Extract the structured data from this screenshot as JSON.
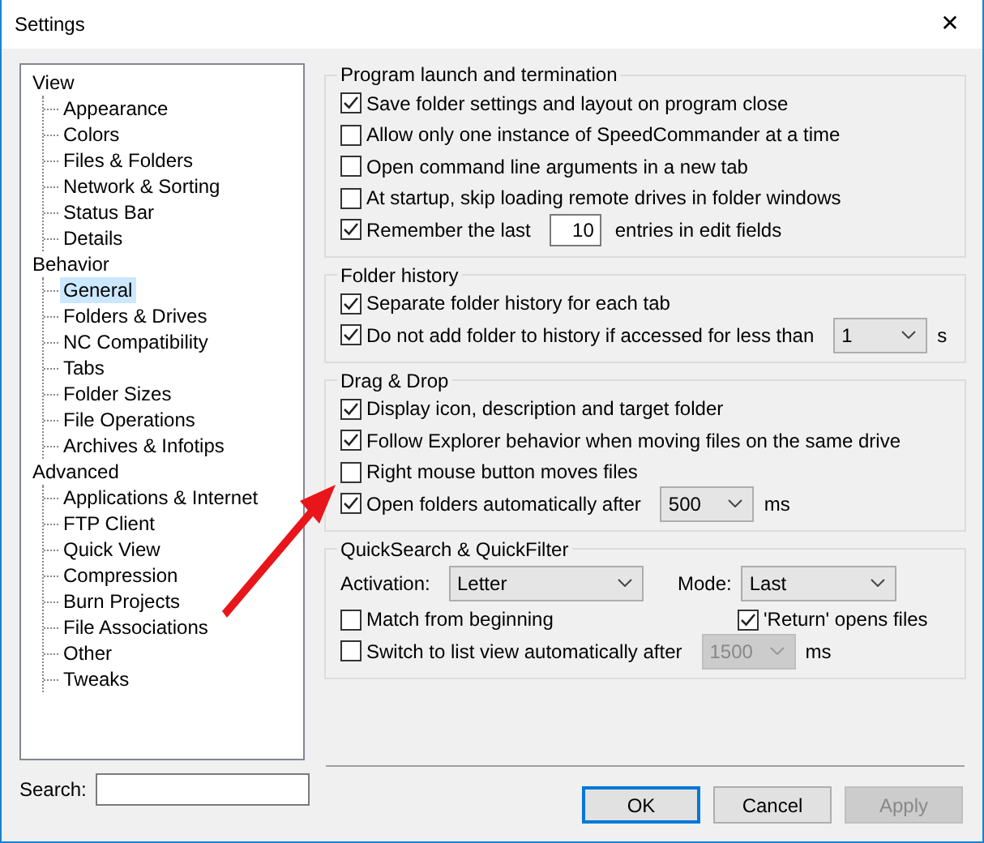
{
  "window": {
    "title": "Settings",
    "close": "✕"
  },
  "tree": [
    {
      "label": "View",
      "selected": false,
      "children": [
        {
          "label": "Appearance",
          "selected": false
        },
        {
          "label": "Colors",
          "selected": false
        },
        {
          "label": "Files & Folders",
          "selected": false
        },
        {
          "label": "Network & Sorting",
          "selected": false
        },
        {
          "label": "Status Bar",
          "selected": false
        },
        {
          "label": "Details",
          "selected": false
        }
      ]
    },
    {
      "label": "Behavior",
      "selected": false,
      "children": [
        {
          "label": "General",
          "selected": true
        },
        {
          "label": "Folders & Drives",
          "selected": false
        },
        {
          "label": "NC Compatibility",
          "selected": false
        },
        {
          "label": "Tabs",
          "selected": false
        },
        {
          "label": "Folder Sizes",
          "selected": false
        },
        {
          "label": "File Operations",
          "selected": false
        },
        {
          "label": "Archives & Infotips",
          "selected": false
        }
      ]
    },
    {
      "label": "Advanced",
      "selected": false,
      "children": [
        {
          "label": "Applications & Internet",
          "selected": false
        },
        {
          "label": "FTP Client",
          "selected": false
        },
        {
          "label": "Quick View",
          "selected": false
        },
        {
          "label": "Compression",
          "selected": false
        },
        {
          "label": "Burn Projects",
          "selected": false
        },
        {
          "label": "File Associations",
          "selected": false
        },
        {
          "label": "Other",
          "selected": false
        },
        {
          "label": "Tweaks",
          "selected": false
        }
      ]
    }
  ],
  "search": {
    "label": "Search:"
  },
  "groups": [
    {
      "title": "Program launch and termination",
      "rows": [
        {
          "kind": "checkbox",
          "label": "Save folder settings and layout on program close",
          "checked": true
        },
        {
          "kind": "checkbox",
          "label": "Allow only one instance of SpeedCommander at a time",
          "checked": false
        },
        {
          "kind": "checkbox",
          "label": "Open command line arguments in a new tab",
          "checked": false
        },
        {
          "kind": "checkbox",
          "label": "At startup, skip loading remote drives in folder windows",
          "checked": false
        },
        {
          "kind": "spin",
          "label": "Remember the last",
          "checked": true,
          "value": "10",
          "suffix": "entries in edit fields"
        }
      ]
    },
    {
      "title": "Folder history",
      "rows": [
        {
          "kind": "checkbox",
          "label": "Separate folder history for each tab",
          "checked": true
        },
        {
          "kind": "select",
          "label": "Do not add folder to history if accessed for less than",
          "checked": true,
          "value": "1",
          "suffix": "s"
        }
      ]
    },
    {
      "title": "Drag & Drop",
      "rows": [
        {
          "kind": "checkbox",
          "label": "Display icon, description and target folder",
          "checked": true
        },
        {
          "kind": "checkbox",
          "label": "Follow Explorer behavior when moving files on the same drive",
          "checked": true
        },
        {
          "kind": "checkbox",
          "label": "Right mouse button moves files",
          "checked": false
        },
        {
          "kind": "select",
          "label": "Open folders automatically after",
          "checked": true,
          "value": "500",
          "suffix": "ms"
        }
      ]
    }
  ],
  "quicksearch": {
    "title": "QuickSearch & QuickFilter",
    "activation": {
      "label": "Activation:",
      "value": "Letter"
    },
    "mode": {
      "label": "Mode:",
      "value": "Last"
    },
    "match": {
      "label": "Match from beginning",
      "checked": false
    },
    "return": {
      "label": "'Return' opens files",
      "checked": true
    },
    "switch": {
      "label": "Switch to list view automatically after",
      "checked": false,
      "value": "1500",
      "disabled": true,
      "suffix": "ms"
    }
  },
  "buttons": [
    {
      "label": "OK",
      "kind": "default",
      "disabled": false
    },
    {
      "label": "Cancel",
      "kind": "normal",
      "disabled": false
    },
    {
      "label": "Apply",
      "kind": "normal",
      "disabled": true
    }
  ]
}
